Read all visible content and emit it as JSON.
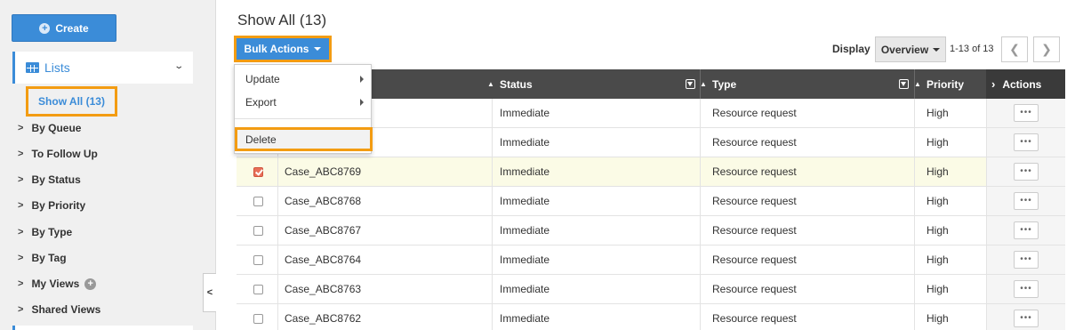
{
  "sidebar": {
    "create_label": "Create",
    "lists_label": "Lists",
    "show_all_label": "Show All (13)",
    "items": [
      {
        "label": "By Queue"
      },
      {
        "label": "To Follow Up"
      },
      {
        "label": "By Status"
      },
      {
        "label": "By Priority"
      },
      {
        "label": "By Type"
      },
      {
        "label": "By Tag"
      },
      {
        "label": "My Views"
      },
      {
        "label": "Shared Views"
      }
    ]
  },
  "header": {
    "title": "Show All (13)",
    "bulk_actions_label": "Bulk Actions",
    "display_label": "Display",
    "view_label": "Overview",
    "pager_text": "1-13 of 13"
  },
  "menu": {
    "items": [
      {
        "label": "Update"
      },
      {
        "label": "Export"
      }
    ],
    "delete_label": "Delete"
  },
  "table": {
    "columns": {
      "status": "Status",
      "type": "Type",
      "priority": "Priority",
      "actions": "Actions"
    },
    "rows": [
      {
        "name": "",
        "status": "Immediate",
        "type": "Resource request",
        "priority": "High",
        "checked": false
      },
      {
        "name": "",
        "status": "Immediate",
        "type": "Resource request",
        "priority": "High",
        "checked": false
      },
      {
        "name": "Case_ABC8769",
        "status": "Immediate",
        "type": "Resource request",
        "priority": "High",
        "checked": true
      },
      {
        "name": "Case_ABC8768",
        "status": "Immediate",
        "type": "Resource request",
        "priority": "High",
        "checked": false
      },
      {
        "name": "Case_ABC8767",
        "status": "Immediate",
        "type": "Resource request",
        "priority": "High",
        "checked": false
      },
      {
        "name": "Case_ABC8764",
        "status": "Immediate",
        "type": "Resource request",
        "priority": "High",
        "checked": false
      },
      {
        "name": "Case_ABC8763",
        "status": "Immediate",
        "type": "Resource request",
        "priority": "High",
        "checked": false
      },
      {
        "name": "Case_ABC8762",
        "status": "Immediate",
        "type": "Resource request",
        "priority": "High",
        "checked": false
      }
    ]
  },
  "colors": {
    "accent": "#3b8cd8",
    "highlight": "#f39c12",
    "header_bg": "#4a4a4a",
    "selected_row": "#fbfbe6"
  }
}
